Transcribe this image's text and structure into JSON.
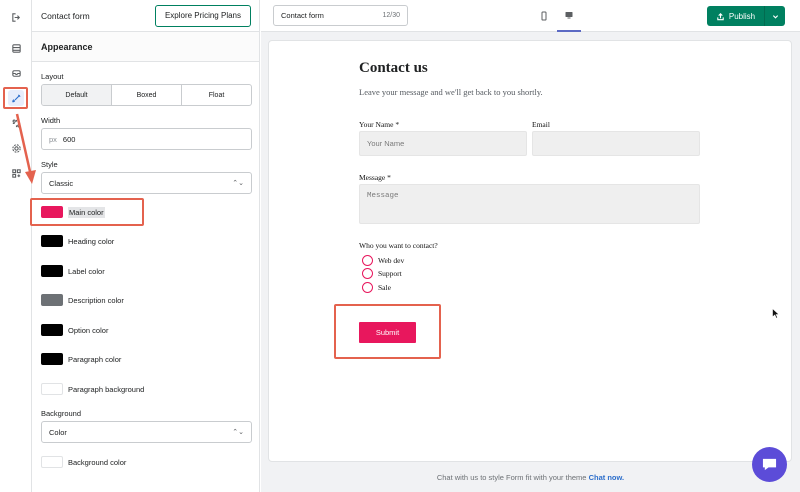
{
  "panel": {
    "title": "Contact form",
    "pricing_button": "Explore Pricing Plans",
    "section_title": "Appearance"
  },
  "layout": {
    "label": "Layout",
    "options": [
      "Default",
      "Boxed",
      "Float"
    ],
    "selected": "Default"
  },
  "width": {
    "label": "Width",
    "unit": "px",
    "value": "600"
  },
  "style": {
    "label": "Style",
    "value": "Classic"
  },
  "colors": [
    {
      "label": "Main color",
      "color": "#e8175d"
    },
    {
      "label": "Heading color",
      "color": "#000000"
    },
    {
      "label": "Label color",
      "color": "#000000"
    },
    {
      "label": "Description color",
      "color": "#6d7175"
    },
    {
      "label": "Option color",
      "color": "#000000"
    },
    {
      "label": "Paragraph color",
      "color": "#000000"
    },
    {
      "label": "Paragraph background",
      "color": "#ffffff"
    }
  ],
  "background": {
    "label": "Background",
    "value": "Color",
    "color_label": "Background color",
    "color": "#ffffff"
  },
  "topbar": {
    "form_name": "Contact form",
    "counter": "12/30",
    "publish_label": "Publish"
  },
  "form": {
    "title": "Contact us",
    "description": "Leave your message and we'll get back to you shortly.",
    "name_label": "Your Name *",
    "name_placeholder": "Your Name",
    "email_label": "Email",
    "message_label": "Message *",
    "message_placeholder": "Message",
    "contact_label": "Who you want to contact?",
    "contact_options": [
      "Web dev",
      "Support",
      "Sale"
    ],
    "submit_label": "Submit"
  },
  "footer": {
    "text": "Chat with us to style Form fit with your theme",
    "link": "Chat now."
  },
  "theme": {
    "accent": "#e8175d",
    "primary": "#008060",
    "annotation": "#e4624e",
    "chat": "#5c4cd8"
  }
}
